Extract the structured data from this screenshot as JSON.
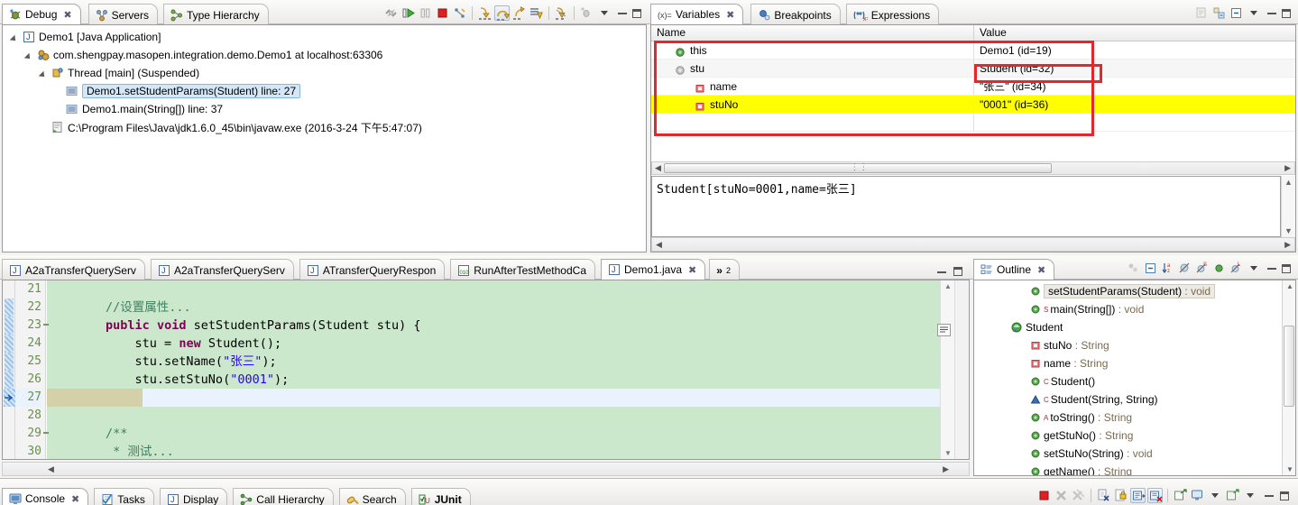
{
  "debug_view": {
    "tabs": [
      {
        "label": "Debug",
        "icon": "debug-icon",
        "active": true,
        "closable": true
      },
      {
        "label": "Servers",
        "icon": "servers-icon",
        "active": false,
        "closable": false
      },
      {
        "label": "Type Hierarchy",
        "icon": "type-hierarchy-icon",
        "active": false,
        "closable": false
      }
    ],
    "toolbar_icons": [
      "disconnect-icon",
      "resume-icon",
      "suspend-icon",
      "terminate-icon",
      "disconnect2-icon",
      "step-into-icon",
      "step-over-icon",
      "step-return-icon",
      "drop-to-frame-icon",
      "use-step-filters-icon",
      "view-menu-icon",
      "minimize-icon",
      "maximize-icon"
    ],
    "tree": [
      {
        "indent": 0,
        "arrow": "open",
        "icon": "java-app-icon",
        "label": "Demo1 [Java Application]",
        "selected": false
      },
      {
        "indent": 1,
        "arrow": "open",
        "icon": "debug-target-icon",
        "label": "com.shengpay.masopen.integration.demo.Demo1 at localhost:63306",
        "selected": false
      },
      {
        "indent": 2,
        "arrow": "open",
        "icon": "thread-icon",
        "label": "Thread [main] (Suspended)",
        "selected": false
      },
      {
        "indent": 3,
        "arrow": "none",
        "icon": "stack-frame-icon",
        "label": "Demo1.setStudentParams(Student) line: 27",
        "selected": true
      },
      {
        "indent": 3,
        "arrow": "none",
        "icon": "stack-frame-icon",
        "label": "Demo1.main(String[]) line: 37",
        "selected": false
      },
      {
        "indent": 2,
        "arrow": "none",
        "icon": "process-icon",
        "label": "C:\\Program Files\\Java\\jdk1.6.0_45\\bin\\javaw.exe (2016-3-24 下午5:47:07)",
        "selected": false
      }
    ]
  },
  "variables_view": {
    "tabs": [
      {
        "label": "Variables",
        "icon": "variables-icon",
        "active": true,
        "closable": true
      },
      {
        "label": "Breakpoints",
        "icon": "breakpoints-icon",
        "active": false,
        "closable": false
      },
      {
        "label": "Expressions",
        "icon": "expressions-icon",
        "active": false,
        "closable": false
      }
    ],
    "toolbar_icons": [
      "show-logical-structure-icon",
      "collapse-all-icon",
      "view-menu-icon",
      "minimize-icon",
      "maximize-icon"
    ],
    "columns": [
      "Name",
      "Value"
    ],
    "rows": [
      {
        "indent": 0,
        "icon": "this-object-icon",
        "name": "this",
        "value": "Demo1  (id=19)",
        "highlight": false,
        "value_boxed": false
      },
      {
        "indent": 0,
        "icon": "local-object-icon",
        "name": "stu",
        "value": "Student  (id=32)",
        "highlight": false,
        "value_boxed": true
      },
      {
        "indent": 1,
        "icon": "field-icon",
        "name": "name",
        "value": "\"张三\" (id=34)",
        "highlight": false,
        "value_boxed": false
      },
      {
        "indent": 1,
        "icon": "field-icon",
        "name": "stuNo",
        "value": "\"0001\" (id=36)",
        "highlight": true,
        "value_boxed": false
      }
    ],
    "detail_text": "Student[stuNo=0001,name=张三]",
    "annotation_color": "#e8262a",
    "highlight_color": "#ffff00"
  },
  "editor": {
    "tabs": [
      {
        "label": "A2aTransferQueryServ",
        "icon": "java-file-icon",
        "active": false
      },
      {
        "label": "A2aTransferQueryServ",
        "icon": "java-file-icon",
        "active": false
      },
      {
        "label": "ATransferQueryRespon",
        "icon": "java-file-icon",
        "active": false
      },
      {
        "label": "RunAfterTestMethodCa",
        "icon": "junit-file-icon",
        "active": false
      },
      {
        "label": "Demo1.java",
        "icon": "java-file-icon",
        "active": true,
        "closable": true
      }
    ],
    "overflow_label": "»",
    "overflow_count": "2",
    "window_buttons": [
      "minimize-icon",
      "maximize-icon"
    ],
    "lines": [
      {
        "no": "21",
        "marker": "",
        "fold": "",
        "current": false,
        "tokens": [
          {
            "t": "",
            "c": "plain"
          }
        ]
      },
      {
        "no": "22",
        "marker": "changed",
        "fold": "",
        "current": false,
        "tokens": [
          {
            "t": "        ",
            "c": "plain"
          },
          {
            "t": "//设置属性...",
            "c": "cmt"
          }
        ]
      },
      {
        "no": "23",
        "marker": "changed",
        "fold": "minus",
        "current": false,
        "tokens": [
          {
            "t": "        ",
            "c": "plain"
          },
          {
            "t": "public ",
            "c": "kw"
          },
          {
            "t": "void ",
            "c": "kw"
          },
          {
            "t": "setStudentParams(Student stu) {",
            "c": "plain"
          }
        ]
      },
      {
        "no": "24",
        "marker": "changed",
        "fold": "",
        "current": false,
        "tokens": [
          {
            "t": "            stu = ",
            "c": "plain"
          },
          {
            "t": "new ",
            "c": "kw"
          },
          {
            "t": "Student();",
            "c": "plain"
          }
        ]
      },
      {
        "no": "25",
        "marker": "changed",
        "fold": "",
        "current": false,
        "tokens": [
          {
            "t": "            stu.setName(",
            "c": "plain"
          },
          {
            "t": "\"张三\"",
            "c": "str"
          },
          {
            "t": ");",
            "c": "plain"
          }
        ]
      },
      {
        "no": "26",
        "marker": "changed",
        "fold": "",
        "current": false,
        "tokens": [
          {
            "t": "            stu.setStuNo(",
            "c": "plain"
          },
          {
            "t": "\"0001\"",
            "c": "str"
          },
          {
            "t": ");",
            "c": "plain"
          }
        ]
      },
      {
        "no": "27",
        "marker": "instruction-pointer",
        "fold": "",
        "current": true,
        "tokens": [
          {
            "t": "        }",
            "c": "plain"
          }
        ]
      },
      {
        "no": "28",
        "marker": "",
        "fold": "",
        "current": false,
        "tokens": [
          {
            "t": "",
            "c": "plain"
          }
        ]
      },
      {
        "no": "29",
        "marker": "",
        "fold": "minus",
        "current": false,
        "tokens": [
          {
            "t": "        ",
            "c": "plain"
          },
          {
            "t": "/**",
            "c": "cmt"
          }
        ]
      },
      {
        "no": "30",
        "marker": "",
        "fold": "",
        "current": false,
        "tokens": [
          {
            "t": "         ",
            "c": "plain"
          },
          {
            "t": "* 测试...",
            "c": "cmt"
          }
        ]
      }
    ]
  },
  "outline_view": {
    "tabs": [
      {
        "label": "Outline",
        "icon": "outline-icon",
        "active": true,
        "closable": true
      }
    ],
    "toolbar_icons": [
      "focus-on-active-task-icon",
      "collapse-all-icon",
      "sort-icon",
      "hide-fields-icon",
      "hide-static-icon",
      "hide-non-public-icon",
      "hide-local-types-icon",
      "view-menu-icon",
      "minimize-icon",
      "maximize-icon"
    ],
    "items": [
      {
        "indent": 2,
        "icon": "public-method-icon",
        "badge": "",
        "label": "setStudentParams(Student)",
        "type": " : void",
        "selected": true
      },
      {
        "indent": 2,
        "icon": "public-method-icon",
        "badge": "S",
        "label": "main(String[])",
        "type": " : void",
        "selected": false
      },
      {
        "indent": 1,
        "icon": "class-icon",
        "badge": "",
        "label": "Student",
        "type": "",
        "selected": false
      },
      {
        "indent": 2,
        "icon": "private-field-icon",
        "badge": "",
        "label": "stuNo",
        "type": " : String",
        "selected": false
      },
      {
        "indent": 2,
        "icon": "private-field-icon",
        "badge": "",
        "label": "name",
        "type": " : String",
        "selected": false
      },
      {
        "indent": 2,
        "icon": "public-method-icon",
        "badge": "C",
        "label": "Student()",
        "type": "",
        "selected": false
      },
      {
        "indent": 2,
        "icon": "protected-method-icon",
        "badge": "C",
        "label": "Student(String, String)",
        "type": "",
        "selected": false
      },
      {
        "indent": 2,
        "icon": "public-method-icon",
        "badge": "A",
        "label": "toString()",
        "type": " : String",
        "selected": false
      },
      {
        "indent": 2,
        "icon": "public-method-icon",
        "badge": "",
        "label": "getStuNo()",
        "type": " : String",
        "selected": false
      },
      {
        "indent": 2,
        "icon": "public-method-icon",
        "badge": "",
        "label": "setStuNo(String)",
        "type": " : void",
        "selected": false
      },
      {
        "indent": 2,
        "icon": "public-method-icon",
        "badge": "",
        "label": "getName()",
        "type": " : String",
        "selected": false
      }
    ]
  },
  "bottom_bar": {
    "tabs": [
      {
        "label": "Console",
        "icon": "console-icon",
        "active": true,
        "closable": true
      },
      {
        "label": "Tasks",
        "icon": "tasks-icon",
        "active": false
      },
      {
        "label": "Display",
        "icon": "display-icon",
        "active": false
      },
      {
        "label": "Call Hierarchy",
        "icon": "call-hierarchy-icon",
        "active": false
      },
      {
        "label": "Search",
        "icon": "search-icon",
        "active": false
      },
      {
        "label": "JUnit",
        "icon": "junit-icon",
        "active": false,
        "bold": true
      }
    ],
    "toolbar_icons": [
      "terminate-icon",
      "remove-launch-icon",
      "remove-all-terminated-icon",
      "clear-console-icon",
      "scroll-lock-icon",
      "show-console-on-output-icon",
      "show-console-on-error-icon",
      "pin-console-icon",
      "display-selected-console-icon",
      "display-selected-console-menu-icon",
      "open-console-icon",
      "open-console-menu-icon",
      "minimize-icon",
      "maximize-icon"
    ]
  }
}
